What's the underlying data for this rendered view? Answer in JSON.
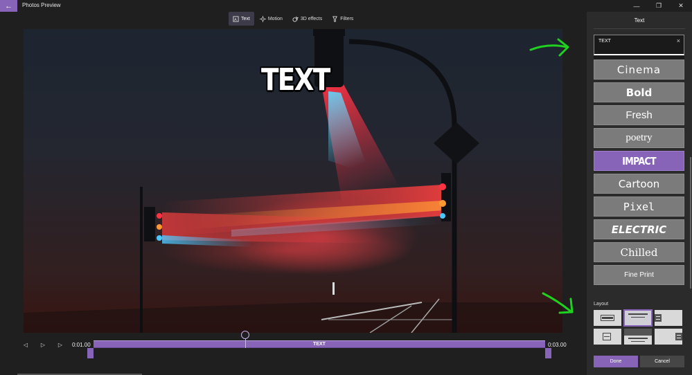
{
  "app": {
    "title": "Photos Preview"
  },
  "toolbar": {
    "items": [
      {
        "label": "Text",
        "icon": "text-icon",
        "active": true
      },
      {
        "label": "Motion",
        "icon": "motion-icon",
        "active": false
      },
      {
        "label": "3D effects",
        "icon": "3d-effects-icon",
        "active": false
      },
      {
        "label": "Filters",
        "icon": "filters-icon",
        "active": false
      }
    ]
  },
  "preview": {
    "overlay_text": "TEXT"
  },
  "timeline": {
    "start_time": "0:01.00",
    "end_time": "0:03.00",
    "clip_label": "TEXT"
  },
  "panel": {
    "title": "Text",
    "text_input": {
      "value": "TEXT",
      "clear_icon": "close-icon"
    },
    "styles": [
      {
        "label": "Cinema",
        "selected": false
      },
      {
        "label": "Bold",
        "selected": false
      },
      {
        "label": "Fresh",
        "selected": false
      },
      {
        "label": "poetry",
        "selected": false
      },
      {
        "label": "IMPACT",
        "selected": true
      },
      {
        "label": "Cartoon",
        "selected": false
      },
      {
        "label": "Pixel",
        "selected": false
      },
      {
        "label": "ELECTRIC",
        "selected": false
      },
      {
        "label": "Chilled",
        "selected": false
      },
      {
        "label": "Fine Print",
        "selected": false
      }
    ],
    "layout_label": "Layout",
    "done_label": "Done",
    "cancel_label": "Cancel"
  },
  "colors": {
    "accent": "#8764b8",
    "panel_bg": "#2b2b2b",
    "annotation_arrow": "#1fd21f"
  }
}
